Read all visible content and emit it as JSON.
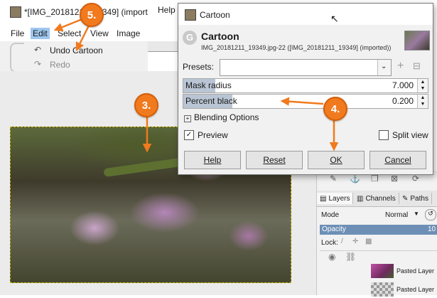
{
  "main_window": {
    "title": "*[IMG_20181211_19349] (importe",
    "menu": [
      "File",
      "Edit",
      "Select",
      "View",
      "Image"
    ],
    "right_menu": "Help",
    "edit_dropdown": {
      "undo": "Undo Cartoon",
      "redo": "Redo"
    }
  },
  "dialog": {
    "title": "Cartoon",
    "heading": "Cartoon",
    "subtitle": "IMG_20181211_19349.jpg-22 ([IMG_20181211_19349] (imported))",
    "presets_label": "Presets:",
    "presets_value": "",
    "mask_radius": {
      "label": "Mask radius",
      "value": "7.000",
      "fraction": 0.13
    },
    "percent_black": {
      "label": "Percent black",
      "value": "0.200",
      "fraction": 0.2
    },
    "blending_options": "Blending Options",
    "preview": {
      "label": "Preview",
      "checked": true
    },
    "split_view": {
      "label": "Split view",
      "checked": false
    },
    "buttons": {
      "help": "Help",
      "reset": "Reset",
      "ok": "OK",
      "cancel": "Cancel"
    }
  },
  "dock": {
    "tabs": [
      "Layers",
      "Channels",
      "Paths"
    ],
    "mode_label": "Mode",
    "mode_value": "Normal",
    "opacity_label": "Opacity",
    "opacity_value": "10",
    "lock_label": "Lock:",
    "layers": [
      "Pasted Layer",
      "Pasted Layer"
    ]
  },
  "annotations": {
    "step_3": "3.",
    "step_4": "4.",
    "step_5": "5.",
    "color": "#f07a1d"
  }
}
